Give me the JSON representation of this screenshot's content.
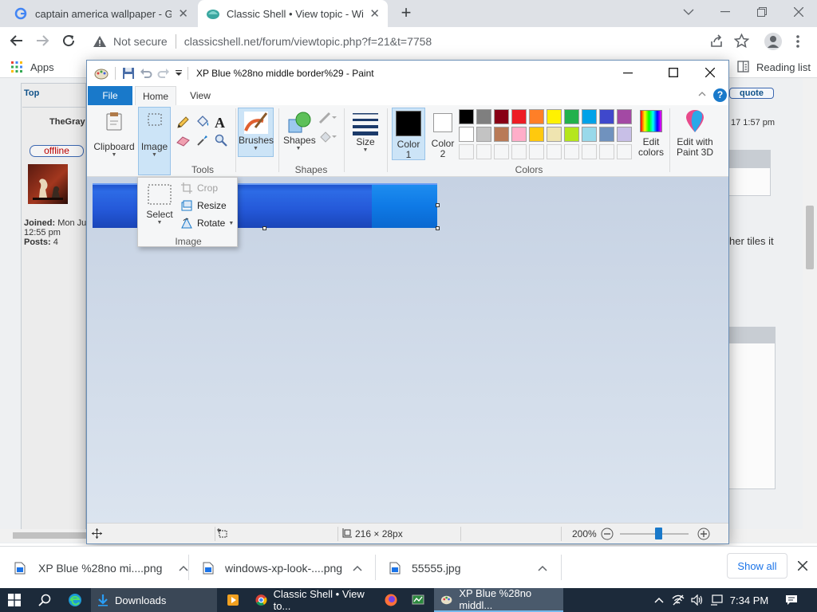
{
  "browser": {
    "tabs": [
      {
        "title": "captain america wallpaper - Goo"
      },
      {
        "title": "Classic Shell • View topic - Wind"
      }
    ],
    "security": "Not secure",
    "url": "classicshell.net/forum/viewtopic.php?f=21&t=7758",
    "bookmarks": {
      "apps": "Apps",
      "reading_list": "Reading list"
    }
  },
  "forum": {
    "top_link": "Top",
    "quote_button": "quote",
    "username": "TheGray",
    "status_badge": "offline",
    "joined_label": "Joined:",
    "joined_value": "Mon Ju",
    "joined_time": "12:55 pm",
    "posts_label": "Posts:",
    "posts_value": "4",
    "post_time": "17 1:57 pm",
    "post_text": "her tiles it"
  },
  "paint": {
    "title": "XP Blue %28no middle border%29 - Paint",
    "tabs": {
      "file": "File",
      "home": "Home",
      "view": "View"
    },
    "ribbon": {
      "clipboard": "Clipboard",
      "image": "Image",
      "tools_group": "Tools",
      "brushes": "Brushes",
      "shapes": "Shapes",
      "shapes_group": "Shapes",
      "size": "Size",
      "color1": "Color",
      "color1_num": "1",
      "color2": "Color",
      "color2_num": "2",
      "edit_colors_1": "Edit",
      "edit_colors_2": "colors",
      "paint3d_1": "Edit with",
      "paint3d_2": "Paint 3D",
      "colors_group": "Colors"
    },
    "palette_row1": [
      "#000000",
      "#7f7f7f",
      "#880015",
      "#ed1c24",
      "#ff7f27",
      "#fff200",
      "#22b14c",
      "#00a2e8",
      "#3f48cc",
      "#a349a4"
    ],
    "palette_row2": [
      "#ffffff",
      "#c3c3c3",
      "#b97a57",
      "#ffaec9",
      "#ffc90e",
      "#efe4b0",
      "#b5e61d",
      "#99d9ea",
      "#7092be",
      "#c8bfe7"
    ],
    "image_dropdown": {
      "select": "Select",
      "crop": "Crop",
      "resize": "Resize",
      "rotate": "Rotate",
      "group": "Image"
    },
    "status": {
      "dimensions": "216 × 28px",
      "zoom": "200%",
      "zoom_fraction": 0.56
    }
  },
  "downloads": {
    "items": [
      {
        "name": "XP Blue %28no mi....png"
      },
      {
        "name": "windows-xp-look-....png"
      },
      {
        "name": "55555.jpg"
      }
    ],
    "show_all": "Show all"
  },
  "taskbar": {
    "downloads": "Downloads",
    "chrome": "Classic Shell • View to...",
    "paint": "XP Blue %28no middl...",
    "time": "7:34 PM"
  }
}
